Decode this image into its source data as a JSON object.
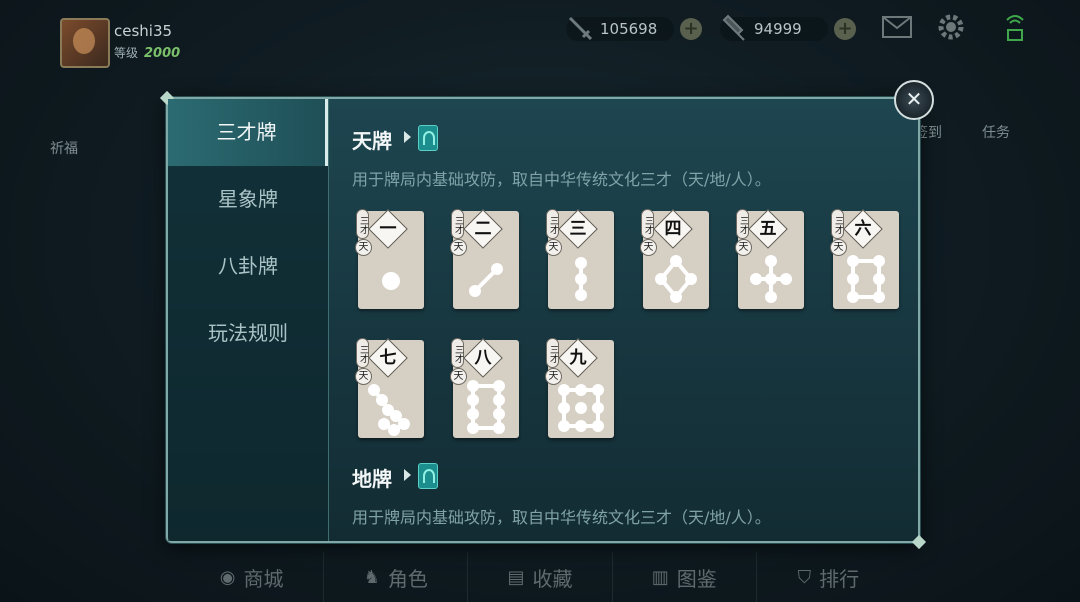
{
  "top": {
    "user_name": "ceshi35",
    "level_label": "等级",
    "level_value": "2000",
    "currency1": "105698",
    "currency2": "94999"
  },
  "side": {
    "left_label": "祈福",
    "right_label1": "签到",
    "right_label2": "任务"
  },
  "dialog": {
    "tabs": [
      {
        "label": "三才牌"
      },
      {
        "label": "星象牌"
      },
      {
        "label": "八卦牌"
      },
      {
        "label": "玩法规则"
      }
    ],
    "section1": {
      "title": "天牌",
      "desc": "用于牌局内基础攻防，取自中华传统文化三才（天/地/人）。"
    },
    "section2": {
      "title": "地牌",
      "desc": "用于牌局内基础攻防，取自中华传统文化三才（天/地/人）。"
    },
    "card_tag_top": "三才",
    "card_tag_bottom": "天",
    "cards": [
      {
        "num": "一",
        "value": 1
      },
      {
        "num": "二",
        "value": 2
      },
      {
        "num": "三",
        "value": 3
      },
      {
        "num": "四",
        "value": 4
      },
      {
        "num": "五",
        "value": 5
      },
      {
        "num": "六",
        "value": 6
      },
      {
        "num": "七",
        "value": 7
      },
      {
        "num": "八",
        "value": 8
      },
      {
        "num": "九",
        "value": 9
      }
    ]
  },
  "bottom_nav": [
    {
      "label": "商城",
      "icon": "eye-icon"
    },
    {
      "label": "角色",
      "icon": "character-icon"
    },
    {
      "label": "收藏",
      "icon": "collection-icon"
    },
    {
      "label": "图鉴",
      "icon": "book-icon"
    },
    {
      "label": "排行",
      "icon": "rank-icon"
    }
  ]
}
